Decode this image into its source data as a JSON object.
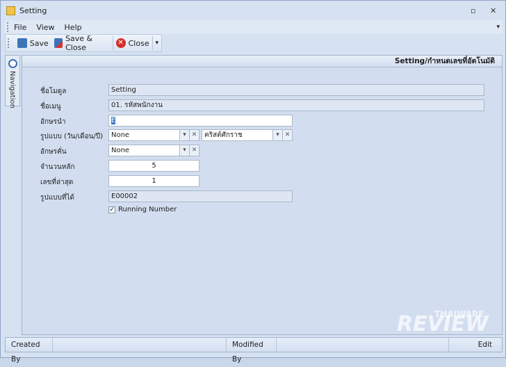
{
  "window": {
    "title": "Setting",
    "minimize": "▫",
    "close": "✕"
  },
  "menu": [
    "File",
    "View",
    "Help"
  ],
  "toolbar": {
    "save": "Save",
    "save_close": "Save & Close",
    "close": "Close",
    "more": "▾"
  },
  "navigation": {
    "label": "Navigation"
  },
  "header": {
    "title": "Setting/กำหนดเลขที่อัตโนมัติ"
  },
  "form": {
    "module_label": "ชื่อโมดูล",
    "module_value": "Setting",
    "menu_label": "ชื่อเมนู",
    "menu_value": "01. รหัสพนักงาน",
    "prefix_label": "อักษรนำ",
    "prefix_value": "E",
    "format_label": "รูปแบบ (วัน/เดือน/ปี)",
    "format_value": "None",
    "era_value": "คริสต์ศักราช",
    "separator_label": "อักษรคั่น",
    "separator_value": "None",
    "digits_label": "จำนวนหลัก",
    "digits_value": "5",
    "last_label": "เลขที่ล่าสุด",
    "last_value": "1",
    "result_label": "รูปแบบที่ได้",
    "result_value": "E00002",
    "running_label": "Running Number",
    "running_checked": true
  },
  "status": {
    "created": "Created By",
    "modified": "Modified By",
    "mode": "Edit"
  },
  "watermark": {
    "top": "THAIWARE",
    "main": "REVIEW"
  }
}
